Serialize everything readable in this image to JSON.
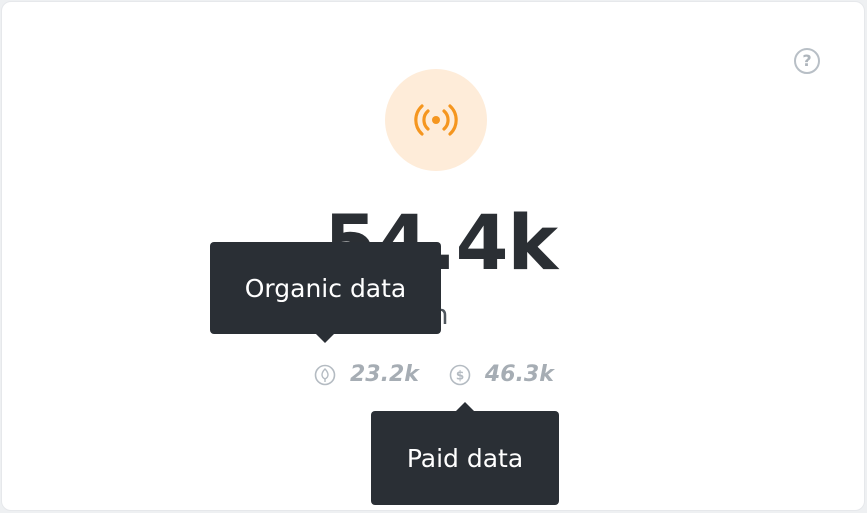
{
  "colors": {
    "accent": "#f5961f",
    "accent_bg": "#feecd9",
    "tooltip_bg": "#2a2f35",
    "muted": "#a6adb4",
    "text": "#2b2f34"
  },
  "card": {
    "help_icon": "question-circle-icon",
    "help_glyph": "?",
    "metric_icon": "broadcast-signal-icon",
    "value": "54.4k",
    "label": "ch"
  },
  "breakdown": {
    "organic": {
      "icon": "leaf-circle-icon",
      "value": "23.2k"
    },
    "paid": {
      "icon": "dollar-circle-icon",
      "value": "46.3k"
    }
  },
  "tooltips": {
    "organic": "Organic data",
    "paid": "Paid data"
  }
}
